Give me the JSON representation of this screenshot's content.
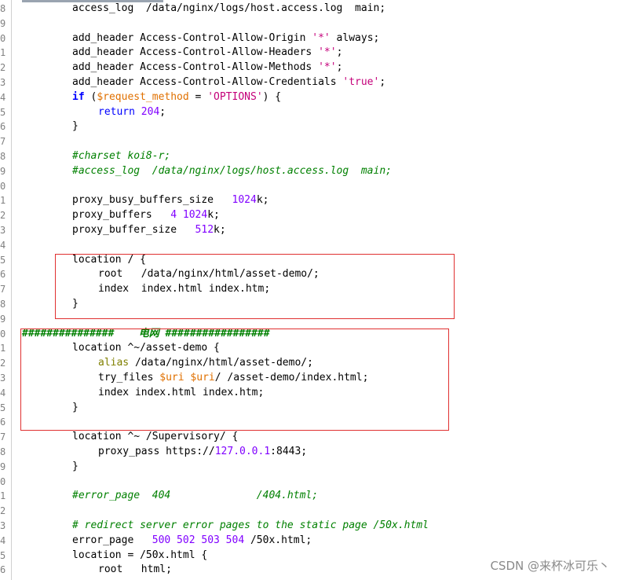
{
  "lines": [
    {
      "n": "8",
      "parts": [
        [
          "",
          "access_log  /data/nginx/logs/host.access.log  main;"
        ]
      ]
    },
    {
      "n": "9",
      "parts": []
    },
    {
      "n": "0",
      "parts": [
        [
          "",
          "add_header Access-Control-Allow-Origin "
        ],
        [
          "str",
          "'*'"
        ],
        [
          "",
          " always;"
        ]
      ]
    },
    {
      "n": "1",
      "parts": [
        [
          "",
          "add_header Access-Control-Allow-Headers "
        ],
        [
          "str",
          "'*'"
        ],
        [
          "",
          ";"
        ]
      ]
    },
    {
      "n": "2",
      "parts": [
        [
          "",
          "add_header Access-Control-Allow-Methods "
        ],
        [
          "str",
          "'*'"
        ],
        [
          "",
          ";"
        ]
      ]
    },
    {
      "n": "3",
      "parts": [
        [
          "",
          "add_header Access-Control-Allow-Credentials "
        ],
        [
          "str",
          "'true'"
        ],
        [
          "",
          ";"
        ]
      ]
    },
    {
      "n": "4",
      "parts": [
        [
          "kw",
          "if"
        ],
        [
          "",
          " ("
        ],
        [
          "var",
          "$request_method"
        ],
        [
          "",
          " = "
        ],
        [
          "str",
          "'OPTIONS'"
        ],
        [
          "",
          ") {"
        ]
      ]
    },
    {
      "n": "5",
      "indent": 1,
      "parts": [
        [
          "kwb",
          "return"
        ],
        [
          "",
          " "
        ],
        [
          "num",
          "204"
        ],
        [
          "",
          ";"
        ]
      ]
    },
    {
      "n": "6",
      "parts": [
        [
          "",
          "}"
        ]
      ]
    },
    {
      "n": "7",
      "parts": []
    },
    {
      "n": "8",
      "parts": [
        [
          "cmt",
          "#charset koi8-r;"
        ]
      ]
    },
    {
      "n": "9",
      "parts": [
        [
          "cmt",
          "#access_log  /data/nginx/logs/host.access.log  main;"
        ]
      ]
    },
    {
      "n": "0",
      "parts": []
    },
    {
      "n": "1",
      "parts": [
        [
          "",
          "proxy_busy_buffers_size   "
        ],
        [
          "num",
          "1024"
        ],
        [
          "",
          "k;"
        ]
      ]
    },
    {
      "n": "2",
      "parts": [
        [
          "",
          "proxy_buffers   "
        ],
        [
          "num",
          "4"
        ],
        [
          "",
          " "
        ],
        [
          "num",
          "1024"
        ],
        [
          "",
          "k;"
        ]
      ]
    },
    {
      "n": "3",
      "parts": [
        [
          "",
          "proxy_buffer_size   "
        ],
        [
          "num",
          "512"
        ],
        [
          "",
          "k;"
        ]
      ]
    },
    {
      "n": "4",
      "parts": []
    },
    {
      "n": "5",
      "parts": [
        [
          "",
          "location / {"
        ]
      ]
    },
    {
      "n": "6",
      "indent": 1,
      "parts": [
        [
          "",
          "root   /data/nginx/html/asset-demo/;"
        ]
      ]
    },
    {
      "n": "7",
      "indent": 1,
      "parts": [
        [
          "",
          "index  index.html index.htm;"
        ]
      ]
    },
    {
      "n": "8",
      "parts": [
        [
          "",
          "}"
        ]
      ]
    },
    {
      "n": "9",
      "parts": []
    },
    {
      "n": "0",
      "hash": true,
      "parts": [
        [
          "hashcmt",
          "###############    电网 #################"
        ]
      ]
    },
    {
      "n": "1",
      "parts": [
        [
          "",
          "location ^~/asset-demo {"
        ]
      ]
    },
    {
      "n": "2",
      "indent": 1,
      "parts": [
        [
          "alias",
          "alias"
        ],
        [
          "",
          " /data/nginx/html/asset-demo/;"
        ]
      ]
    },
    {
      "n": "3",
      "indent": 1,
      "parts": [
        [
          "",
          "try_files "
        ],
        [
          "var",
          "$uri"
        ],
        [
          "",
          " "
        ],
        [
          "var",
          "$uri"
        ],
        [
          "",
          "/ /asset-demo/index.html;"
        ]
      ]
    },
    {
      "n": "4",
      "indent": 1,
      "parts": [
        [
          "",
          "index index.html index.htm;"
        ]
      ]
    },
    {
      "n": "5",
      "parts": [
        [
          "",
          "}"
        ]
      ]
    },
    {
      "n": "6",
      "parts": []
    },
    {
      "n": "7",
      "parts": [
        [
          "",
          "location ^~ /Supervisory/ {"
        ]
      ]
    },
    {
      "n": "8",
      "indent": 1,
      "parts": [
        [
          "",
          "proxy_pass https://"
        ],
        [
          "num",
          "127.0.0.1"
        ],
        [
          "",
          ":8443;"
        ]
      ]
    },
    {
      "n": "9",
      "parts": [
        [
          "",
          "}"
        ]
      ]
    },
    {
      "n": "0",
      "parts": []
    },
    {
      "n": "1",
      "parts": [
        [
          "cmt",
          "#error_page  404              /404.html;"
        ]
      ]
    },
    {
      "n": "2",
      "parts": []
    },
    {
      "n": "3",
      "parts": [
        [
          "cmt",
          "# redirect server error pages to the static page /50x.html"
        ]
      ]
    },
    {
      "n": "4",
      "parts": [
        [
          "",
          "error_page   "
        ],
        [
          "num",
          "500 502 503 504"
        ],
        [
          "",
          " /50x.html;"
        ]
      ]
    },
    {
      "n": "5",
      "parts": [
        [
          "",
          "location = /50x.html {"
        ]
      ]
    },
    {
      "n": "6",
      "indent": 1,
      "parts": [
        [
          "",
          "root   html;"
        ]
      ]
    }
  ],
  "watermark": "CSDN @来杯冰可乐丶",
  "colors": {
    "box_border": "#e03030",
    "comment": "#008000",
    "string": "#c4007a",
    "number": "#8000ff",
    "variable": "#e07000"
  }
}
